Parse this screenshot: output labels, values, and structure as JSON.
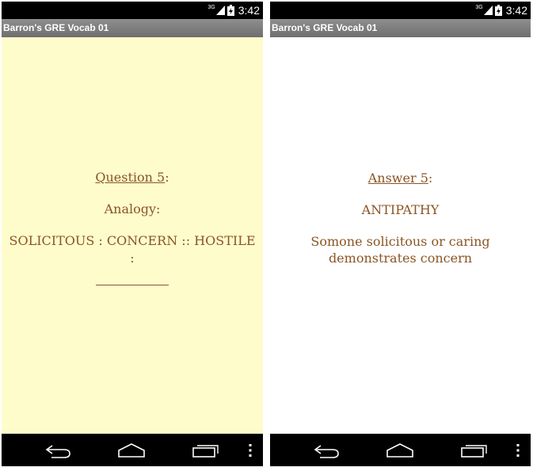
{
  "left": {
    "status": {
      "network": "3G",
      "time": "3:42"
    },
    "title": "Barron's GRE Vocab 01",
    "card": {
      "heading_label": "Question 5",
      "heading_suffix": ":",
      "kind": "Analogy:",
      "prompt": "SOLICITOUS : CONCERN :: HOSTILE :",
      "blank": "__________"
    },
    "background": "#fffccc"
  },
  "right": {
    "status": {
      "network": "3G",
      "time": "3:42"
    },
    "title": "Barron's GRE Vocab 01",
    "card": {
      "heading_label": "Answer 5",
      "heading_suffix": ":",
      "answer": "ANTIPATHY",
      "explanation": "Somone solicitous or caring demonstrates concern"
    },
    "background": "#ffffff"
  },
  "nav_icons": [
    "back-icon",
    "home-icon",
    "recent-apps-icon",
    "overflow-menu-icon"
  ],
  "colors": {
    "text": "#8a5524",
    "titlebar": "#7d7d7d",
    "bars": "#000000"
  }
}
